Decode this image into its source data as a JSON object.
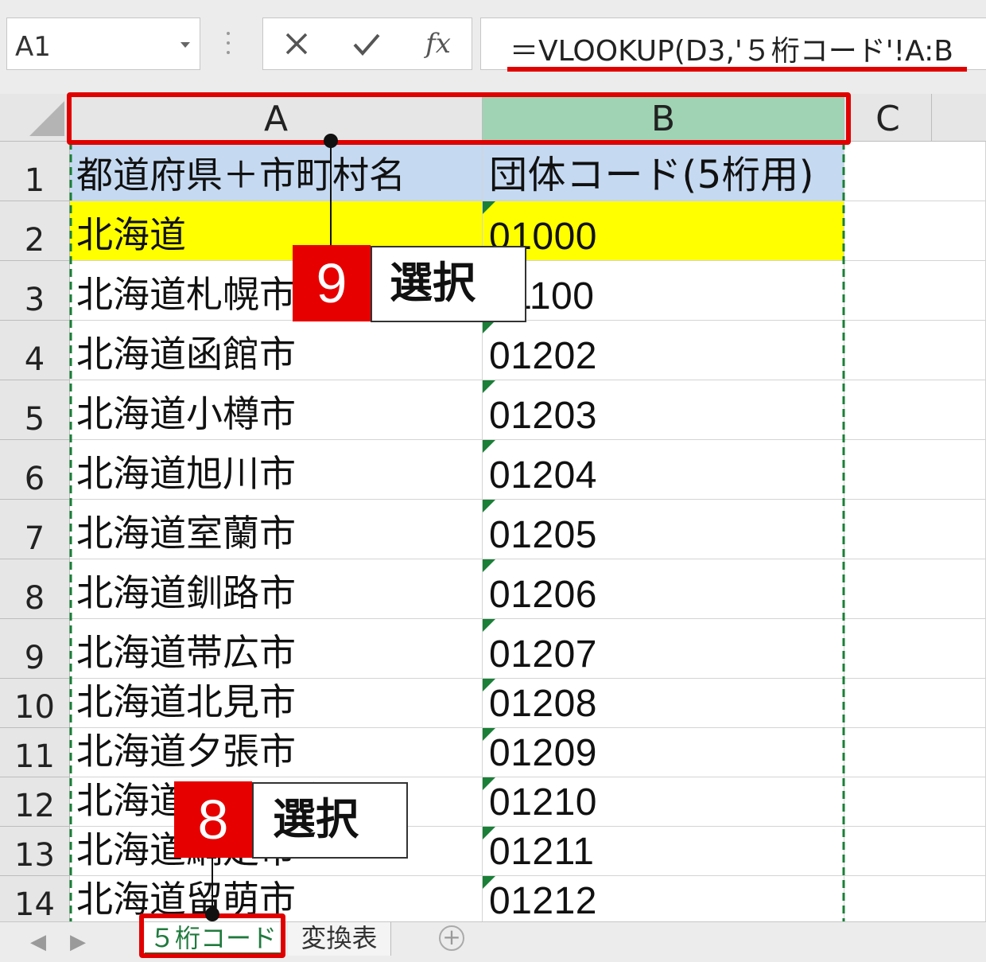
{
  "formula_bar": {
    "name_box": "A1",
    "cancel_icon": "×",
    "enter_icon": "✔",
    "fx_label": "fx",
    "formula": "＝VLOOKUP(D3,'５桁コード'!A:B"
  },
  "columns": [
    "A",
    "B",
    "C"
  ],
  "rows": [
    {
      "num": "1",
      "a": "都道府県＋市町村名",
      "b": "団体コード(5桁用)"
    },
    {
      "num": "2",
      "a": "北海道",
      "b": "01000"
    },
    {
      "num": "3",
      "a": "北海道札幌市",
      "b": "01100"
    },
    {
      "num": "4",
      "a": "北海道函館市",
      "b": "01202"
    },
    {
      "num": "5",
      "a": "北海道小樽市",
      "b": "01203"
    },
    {
      "num": "6",
      "a": "北海道旭川市",
      "b": "01204"
    },
    {
      "num": "7",
      "a": "北海道室蘭市",
      "b": "01205"
    },
    {
      "num": "8",
      "a": "北海道釧路市",
      "b": "01206"
    },
    {
      "num": "9",
      "a": "北海道帯広市",
      "b": "01207"
    },
    {
      "num": "10",
      "a": "北海道北見市",
      "b": "01208"
    },
    {
      "num": "11",
      "a": "北海道夕張市",
      "b": "01209"
    },
    {
      "num": "12",
      "a": "北海道岩見沢市",
      "b": "01210"
    },
    {
      "num": "13",
      "a": "北海道網走市",
      "b": "01211"
    },
    {
      "num": "14",
      "a": "北海道留萌市",
      "b": "01212"
    }
  ],
  "callouts": {
    "step9": {
      "number": "9",
      "text": "選択"
    },
    "step8": {
      "number": "8",
      "text": "選択"
    }
  },
  "sheet_tabs": {
    "nav_prev": "◀",
    "nav_next": "▶",
    "tabs": [
      "５桁コード",
      "変換表"
    ],
    "add": "+"
  },
  "colors": {
    "header_fill": "#c5d9f1",
    "highlight_fill": "#ffff00",
    "annotation_red": "#e00000",
    "selected_column_header": "#9fd3b4",
    "active_tab_green": "#1f7a3d"
  }
}
